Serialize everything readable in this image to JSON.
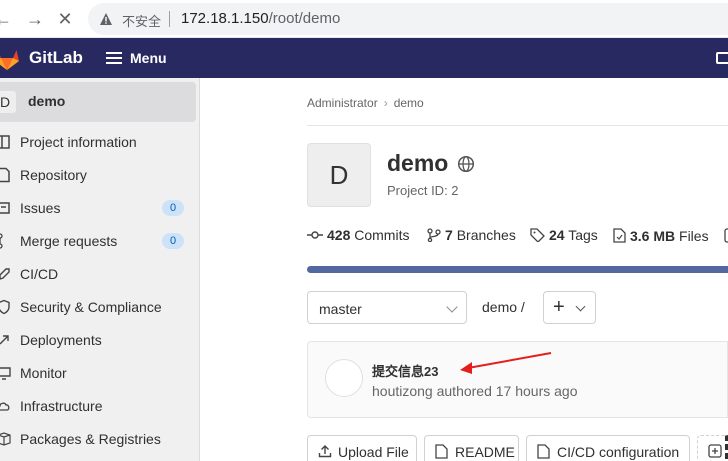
{
  "browser": {
    "back_icon": "arrow-left-icon",
    "forward_icon": "arrow-right-icon",
    "reload_icon": "close-icon",
    "insecure_label": "不安全",
    "url_host": "172.18.1.150",
    "url_path": "/root/demo"
  },
  "topnav": {
    "brand": "GitLab",
    "menu_label": "Menu"
  },
  "sidebar": {
    "project_avatar": "D",
    "project_name": "demo",
    "items": [
      {
        "label": "Project information",
        "icon": "project-icon"
      },
      {
        "label": "Repository",
        "icon": "doc-icon"
      },
      {
        "label": "Issues",
        "icon": "issues-icon",
        "badge": "0"
      },
      {
        "label": "Merge requests",
        "icon": "merge-request-icon",
        "badge": "0"
      },
      {
        "label": "CI/CD",
        "icon": "rocket-icon"
      },
      {
        "label": "Security & Compliance",
        "icon": "shield-icon"
      },
      {
        "label": "Deployments",
        "icon": "deployments-icon"
      },
      {
        "label": "Monitor",
        "icon": "monitor-icon"
      },
      {
        "label": "Infrastructure",
        "icon": "cloud-icon"
      },
      {
        "label": "Packages & Registries",
        "icon": "package-icon"
      }
    ]
  },
  "breadcrumb": {
    "owner": "Administrator",
    "project": "demo"
  },
  "project": {
    "avatar": "D",
    "name": "demo",
    "id_label": "Project ID: 2"
  },
  "stats": {
    "commits_count": "428",
    "commits_label": "Commits",
    "branches_count": "7",
    "branches_label": "Branches",
    "tags_count": "24",
    "tags_label": "Tags",
    "files_size": "3.6 MB",
    "files_label": "Files"
  },
  "repo": {
    "branch": "master",
    "path": "demo",
    "path_sep": "/",
    "add_label": "+"
  },
  "commit": {
    "title": "提交信息23",
    "meta": "houtizong authored 17 hours ago"
  },
  "actions": {
    "upload_label": "Upload File",
    "readme_label": "README",
    "cicd_label": "CI/CD configuration"
  },
  "colors": {
    "nav_bg": "#292961",
    "annotation_arrow": "#e41e1e",
    "badge_bg": "#cbe2f9"
  }
}
